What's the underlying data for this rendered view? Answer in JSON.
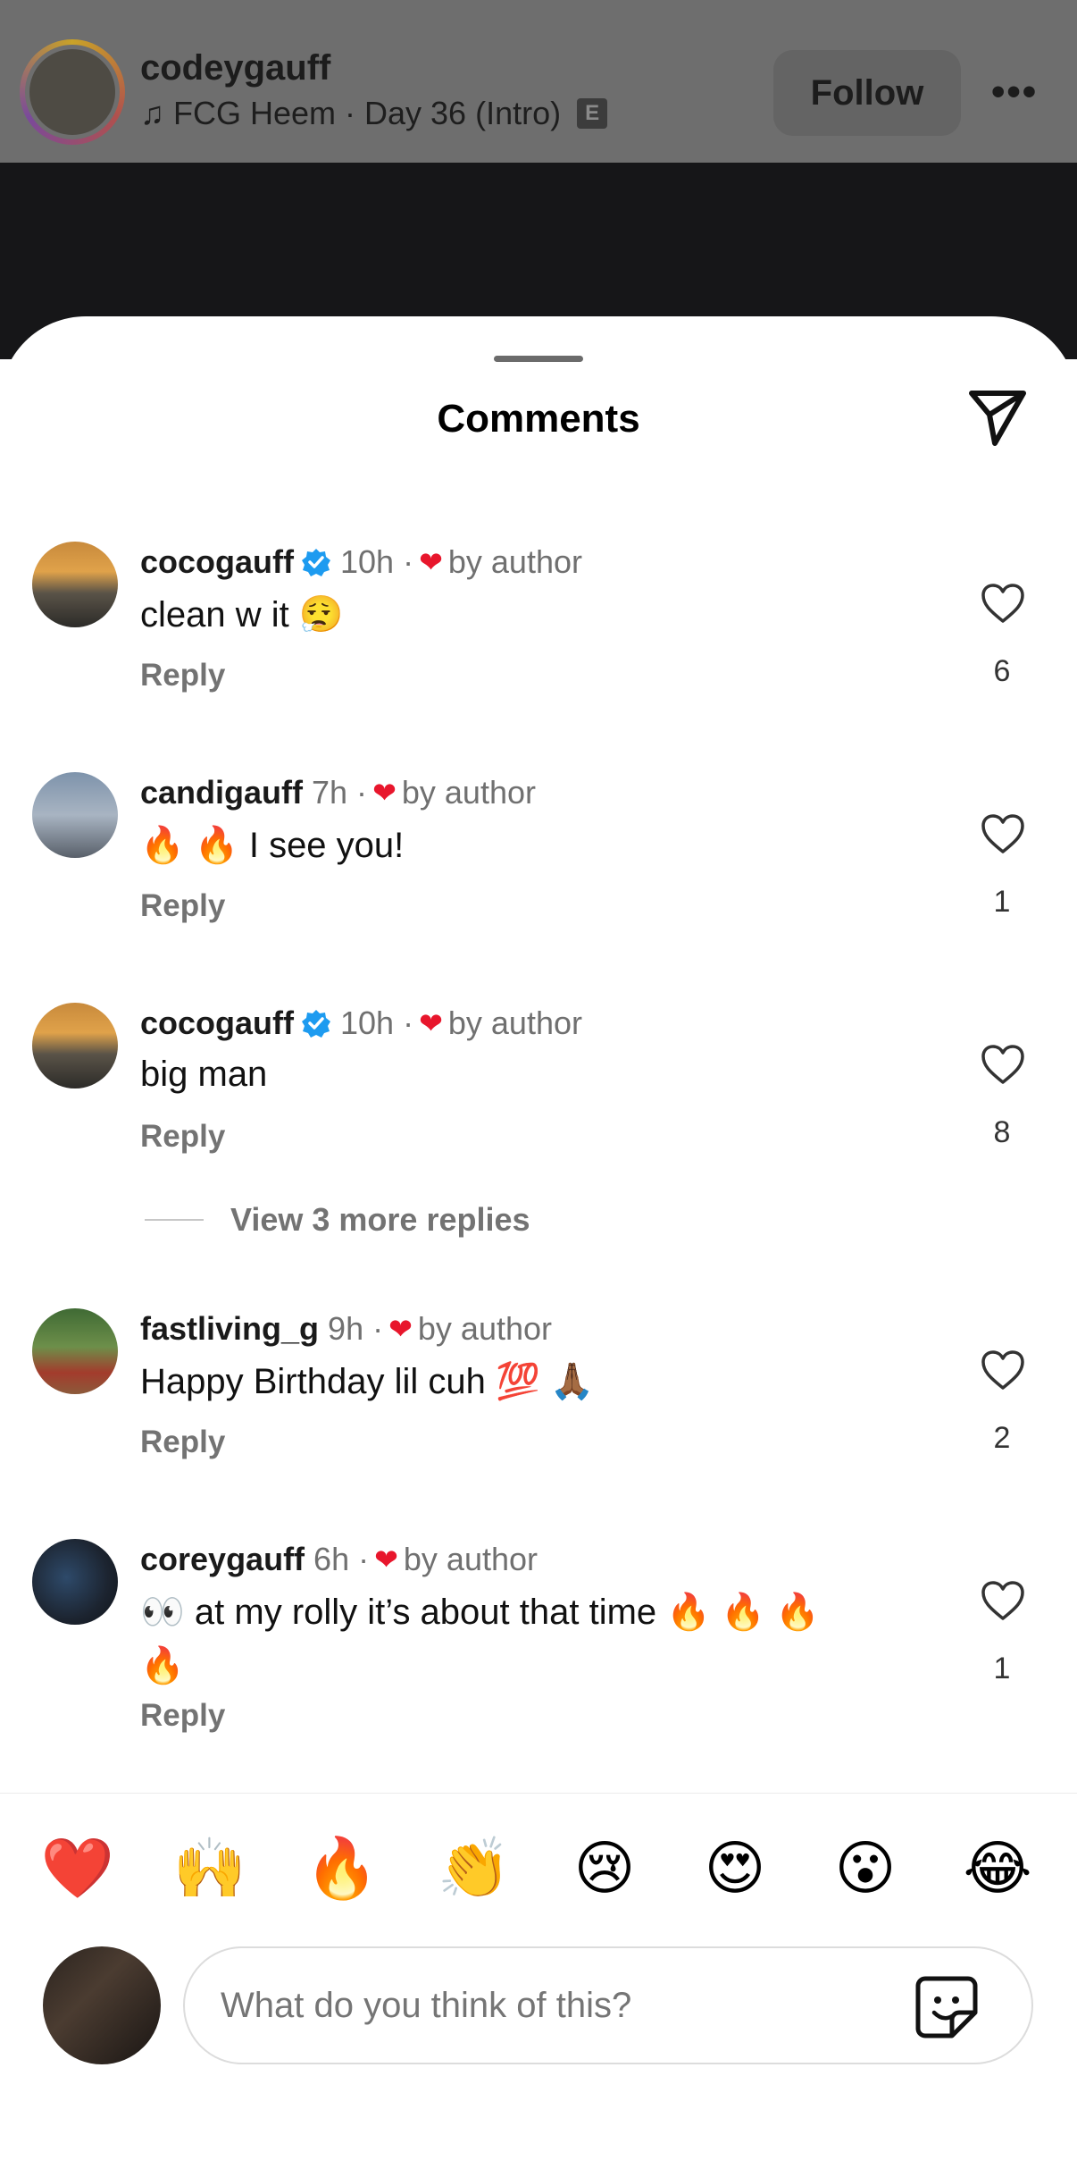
{
  "post_header": {
    "username": "codeygauff",
    "song": "FCG Heem · Day 36 (Intro)",
    "explicit_badge": "E",
    "follow_label": "Follow",
    "more_label": "•••"
  },
  "sheet": {
    "title": "Comments"
  },
  "comments": [
    {
      "username": "cocogauff",
      "verified": true,
      "time": "10h ·",
      "liked_by": "by author",
      "text": "clean w it 😮‍💨",
      "reply": "Reply",
      "likes": "6"
    },
    {
      "username": "candigauff",
      "verified": false,
      "time": "7h ·",
      "liked_by": "by author",
      "text": "🔥 🔥 I see you!",
      "reply": "Reply",
      "likes": "1"
    },
    {
      "username": "cocogauff",
      "verified": true,
      "time": "10h ·",
      "liked_by": "by author",
      "text": "big man",
      "reply": "Reply",
      "likes": "8"
    },
    {
      "username": "fastliving_g",
      "verified": false,
      "time": "9h ·",
      "liked_by": "by author",
      "text": "Happy Birthday lil cuh 💯 🙏🏾",
      "reply": "Reply",
      "likes": "2"
    },
    {
      "username": "coreygauff",
      "verified": false,
      "time": "6h ·",
      "liked_by": "by author",
      "text": "👀 at my rolly it’s about that time  🔥 🔥 🔥",
      "text_line2": "🔥",
      "reply": "Reply",
      "likes": "1"
    }
  ],
  "view_more_replies": "View 3 more replies",
  "quick_reactions": [
    "❤️",
    "🙌",
    "🔥",
    "👏",
    "😢",
    "😍",
    "😮",
    "😂"
  ],
  "composer": {
    "placeholder": "What do you think of this?"
  },
  "colors": {
    "like_red": "#e8162c",
    "verified_blue": "#1d9bf0",
    "muted_text": "#737373"
  }
}
